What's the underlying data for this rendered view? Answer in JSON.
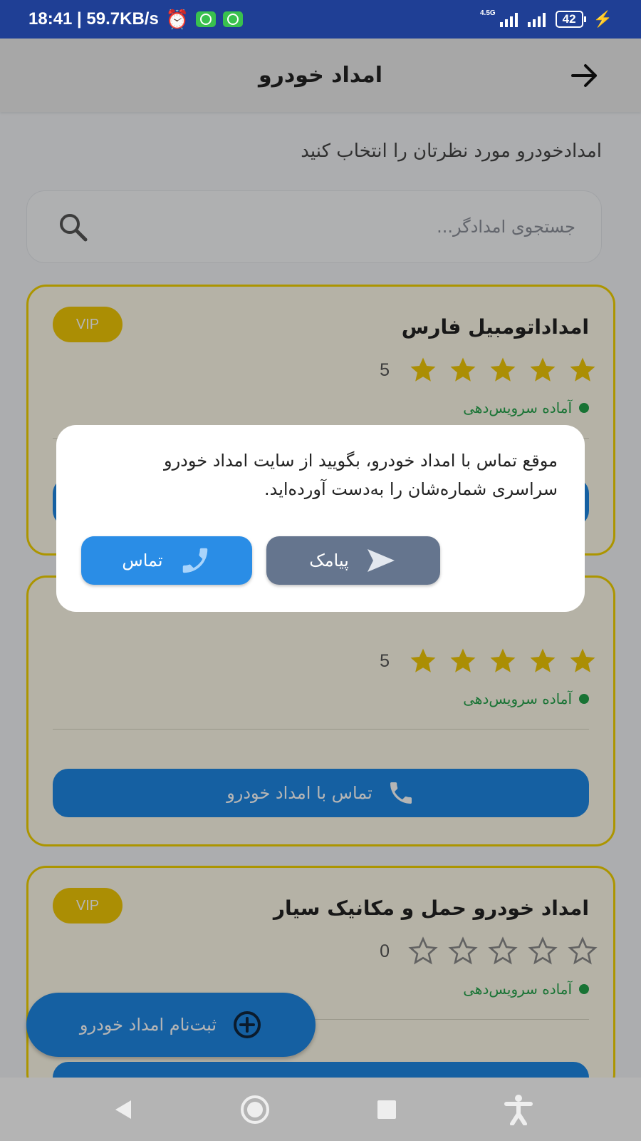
{
  "status_bar": {
    "time_speed": "18:41 | 59.7KB/s",
    "network_tag": "4.5G",
    "battery": "42"
  },
  "header": {
    "title": "امداد خودرو"
  },
  "intro_text": "امدادخودرو مورد نظرتان را انتخاب کنید",
  "search": {
    "placeholder": "جستجوی امدادگر..."
  },
  "cards": [
    {
      "name": "امداداتومبیل فارس",
      "badge": "VIP",
      "rating": 5,
      "rating_label": "5",
      "status": "آماده سرویس‌دهی"
    },
    {
      "name": "",
      "badge": "",
      "rating": 5,
      "rating_label": "5",
      "status": "آماده سرویس‌دهی",
      "call_label": "تماس با امداد خودرو"
    },
    {
      "name": "امداد خودرو حمل و مکانیک سیار",
      "badge": "VIP",
      "rating": 0,
      "rating_label": "0",
      "status": "آماده سرویس‌دهی"
    }
  ],
  "fab": {
    "label": "ثبت‌نام امداد خودرو"
  },
  "dialog": {
    "message": "موقع تماس با امداد خودرو، بگویید از سایت امداد خودرو سراسری شماره‌شان را به‌دست آورده‌اید.",
    "sms_label": "پیامک",
    "call_label": "تماس"
  },
  "colors": {
    "status_bar": "#1f3f95",
    "primary": "#1e88e5",
    "vip": "#f1c806",
    "card_border": "#f3d200",
    "available": "#22a24a",
    "sms_button": "#65758e"
  }
}
